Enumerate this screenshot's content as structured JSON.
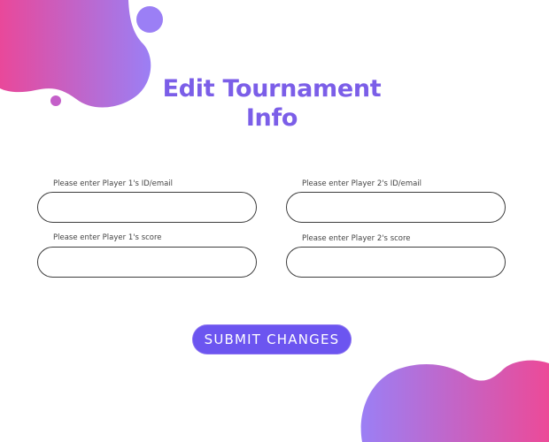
{
  "page": {
    "title": "Edit Tournament Info"
  },
  "form": {
    "player1_id": {
      "label": "Please enter Player 1's ID/email",
      "value": "",
      "placeholder": ""
    },
    "player2_id": {
      "label": "Please enter Player 2's ID/email",
      "value": "",
      "placeholder": ""
    },
    "player1_score": {
      "label": "Please enter Player 1's score",
      "value": "",
      "placeholder": ""
    },
    "player2_score": {
      "label": "Please enter Player 2's score",
      "value": "",
      "placeholder": ""
    },
    "submit_label": "SUBMIT CHANGES"
  },
  "colors": {
    "accent": "#7b5ee8",
    "button": "#6c55f0",
    "blob_gradient_start": "#e9489a",
    "blob_gradient_end": "#9b7ff5"
  }
}
